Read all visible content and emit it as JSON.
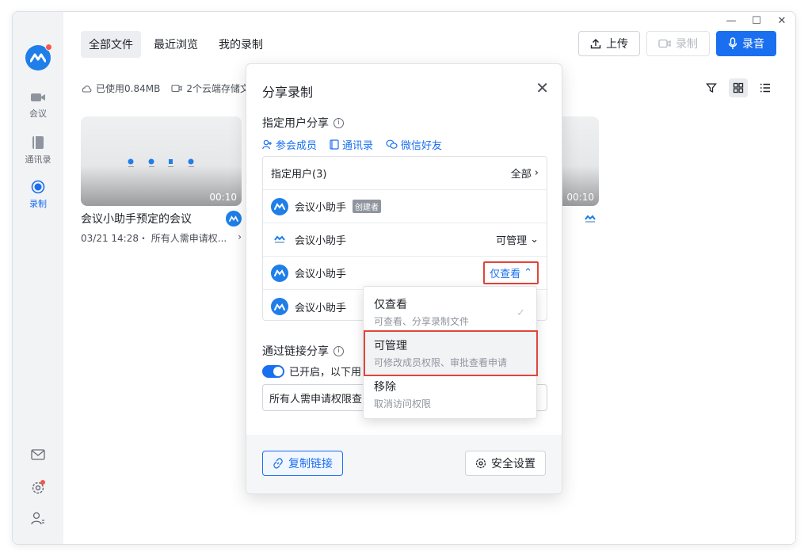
{
  "window_controls": {
    "minimize": "—",
    "maximize": "☐",
    "close": "✕"
  },
  "sidebar": {
    "items": [
      {
        "label": "会议",
        "icon": "video-camera-icon"
      },
      {
        "label": "通讯录",
        "icon": "address-book-icon"
      },
      {
        "label": "录制",
        "icon": "record-icon",
        "active": true
      }
    ]
  },
  "header": {
    "tabs": [
      {
        "label": "全部文件",
        "active": true
      },
      {
        "label": "最近浏览"
      },
      {
        "label": "我的录制"
      }
    ],
    "upload_label": "上传",
    "record_label": "录制",
    "audio_label": "录音"
  },
  "storage": {
    "used": "已使用0.84MB",
    "cloud": "2个云端存储文"
  },
  "cards": [
    {
      "title": "会议小助手预定的会议",
      "duration": "00:10",
      "meta": "03/21 14:28・ 所有人需申请权..."
    },
    {
      "duration": "00:10"
    }
  ],
  "dialog": {
    "title": "分享录制",
    "specified_share": "指定用户分享",
    "links": [
      "参会成员",
      "通讯录",
      "微信好友"
    ],
    "user_header": "指定用户(3)",
    "user_all": "全部",
    "users": [
      {
        "name": "会议小助手",
        "badge": "创建者",
        "perm": ""
      },
      {
        "name": "会议小助手",
        "perm": "可管理"
      },
      {
        "name": "会议小助手",
        "perm": "仅查看"
      },
      {
        "name": "会议小助手",
        "perm": ""
      }
    ],
    "link_share": "通过链接分享",
    "toggle_text": "已开启，以下用",
    "select_value": "所有人需申请权限查",
    "copy_link": "复制链接",
    "security": "安全设置"
  },
  "dropdown": {
    "options": [
      {
        "title": "仅查看",
        "desc": "可查看、分享录制文件",
        "checked": true
      },
      {
        "title": "可管理",
        "desc": "可修改成员权限、审批查看申请"
      },
      {
        "title": "移除",
        "desc": "取消访问权限"
      }
    ],
    "check": "✓"
  },
  "colors": {
    "accent": "#1a6ff0",
    "highlight": "#e0453b"
  }
}
